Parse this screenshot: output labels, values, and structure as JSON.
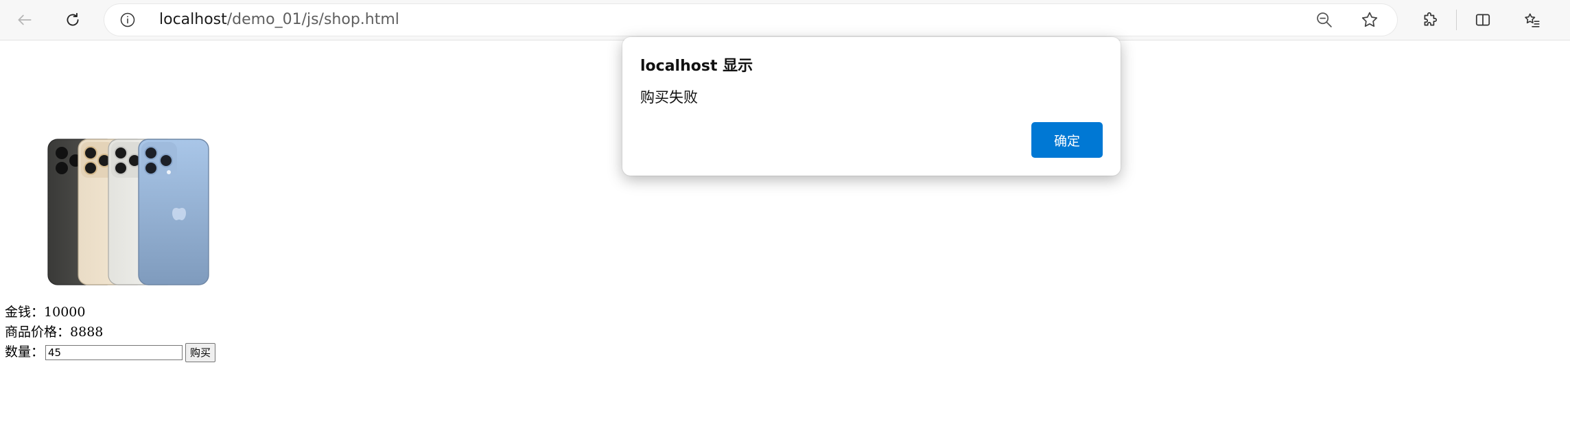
{
  "browser": {
    "url_host": "localhost",
    "url_path": "/demo_01/js/shop.html",
    "icons": [
      "back-arrow-icon",
      "reload-icon",
      "info-icon",
      "zoom-out-icon",
      "favorite-star-icon",
      "extensions-puzzle-icon",
      "split-screen-icon",
      "favorites-list-icon"
    ]
  },
  "page": {
    "money_label": "金钱：",
    "money_value": "10000",
    "price_label": "商品价格：",
    "price_value": "8888",
    "quantity_label": "数量：",
    "quantity_value": "45",
    "buy_button": "购买"
  },
  "dialog": {
    "title": "localhost 显示",
    "message": "购买失败",
    "ok_button": "确定",
    "ok_color": "#0078d4"
  }
}
